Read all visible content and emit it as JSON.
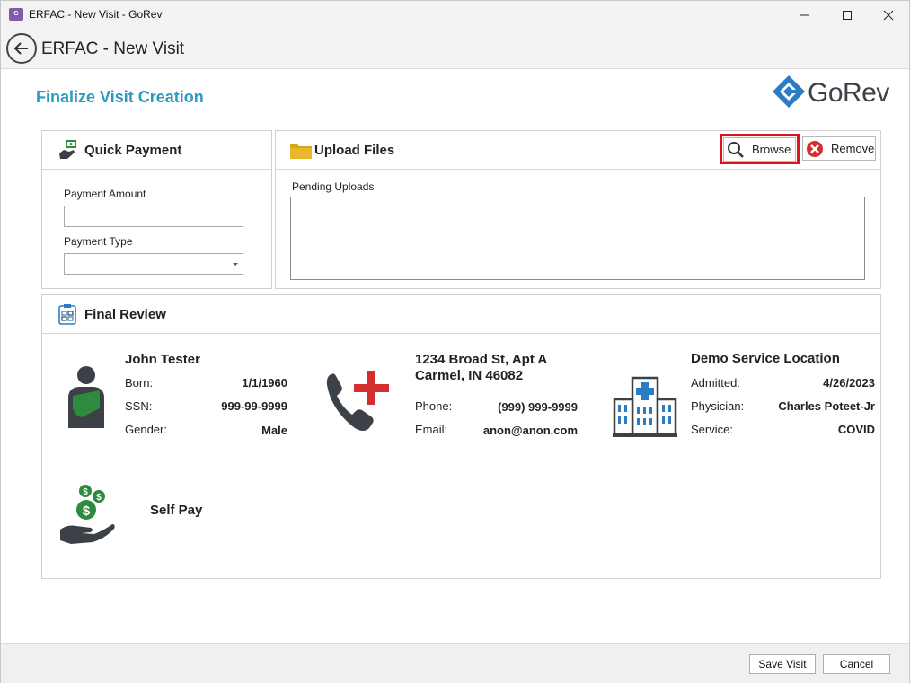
{
  "window": {
    "title": "ERFAC - New Visit - GoRev",
    "app_icon_text": "GoRev"
  },
  "header": {
    "title": "ERFAC - New Visit"
  },
  "page": {
    "title": "Finalize Visit Creation",
    "logo_text": "GoRev"
  },
  "quick_payment": {
    "title": "Quick Payment",
    "amount_label": "Payment Amount",
    "amount_value": "",
    "type_label": "Payment Type",
    "type_value": ""
  },
  "upload_files": {
    "title": "Upload Files",
    "browse_label": "Browse",
    "remove_label": "Remove",
    "pending_label": "Pending Uploads"
  },
  "final_review": {
    "title": "Final Review",
    "patient": {
      "name": "John Tester",
      "born_label": "Born:",
      "born": "1/1/1960",
      "ssn_label": "SSN:",
      "ssn": "999-99-9999",
      "gender_label": "Gender:",
      "gender": "Male"
    },
    "contact": {
      "address_line1": "1234 Broad St, Apt A",
      "address_line2": "Carmel, IN 46082",
      "phone_label": "Phone:",
      "phone": "(999) 999-9999",
      "email_label": "Email:",
      "email": "anon@anon.com"
    },
    "location": {
      "name": "Demo Service Location",
      "admitted_label": "Admitted:",
      "admitted": "4/26/2023",
      "physician_label": "Physician:",
      "physician": "Charles Poteet-Jr",
      "service_label": "Service:",
      "service": "COVID"
    },
    "payer": {
      "name": "Self Pay"
    }
  },
  "footer": {
    "save_label": "Save Visit",
    "cancel_label": "Cancel"
  },
  "colors": {
    "accent": "#2b9cc0",
    "icon_green": "#2e8b3d",
    "icon_red": "#d32f2f",
    "icon_dark": "#3c4148",
    "highlight": "#e0101c"
  }
}
